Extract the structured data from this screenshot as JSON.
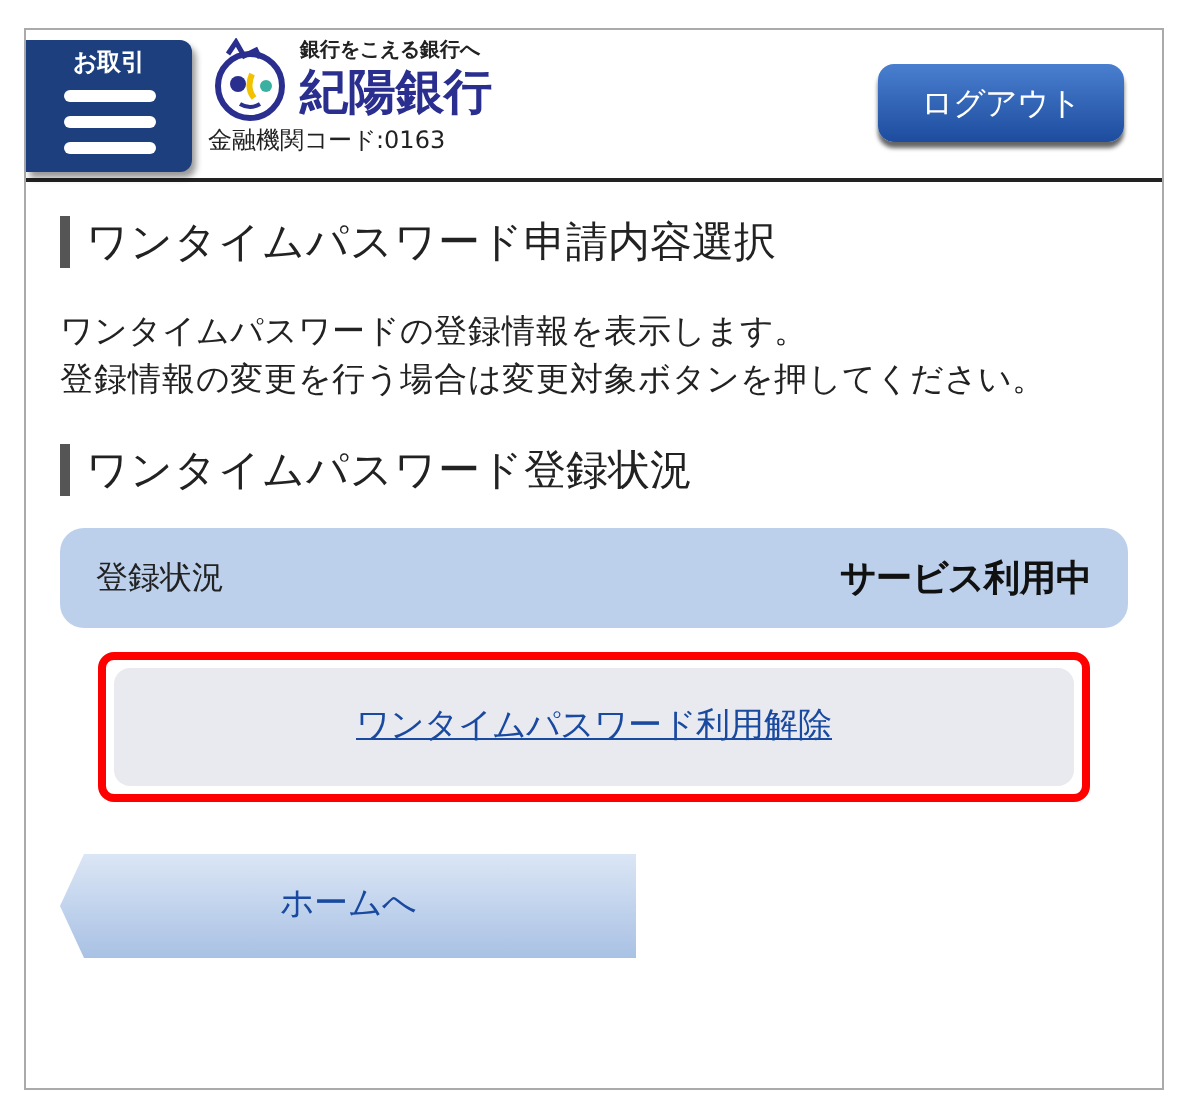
{
  "header": {
    "menu_label": "お取引",
    "tagline": "銀行をこえる銀行へ",
    "bank_name": "紀陽銀行",
    "bank_code": "金融機関コード:0163",
    "logout": "ログアウト"
  },
  "title": "ワンタイムパスワード申請内容選択",
  "description": [
    "ワンタイムパスワードの登録情報を表示します。",
    "登録情報の変更を行う場合は変更対象ボタンを押してください。"
  ],
  "section": {
    "title": "ワンタイムパスワード登録状況",
    "status_label": "登録状況",
    "status_value": "サービス利用中"
  },
  "action": {
    "label": "ワンタイムパスワード利用解除",
    "highlighted": true
  },
  "home_button": "ホームへ"
}
